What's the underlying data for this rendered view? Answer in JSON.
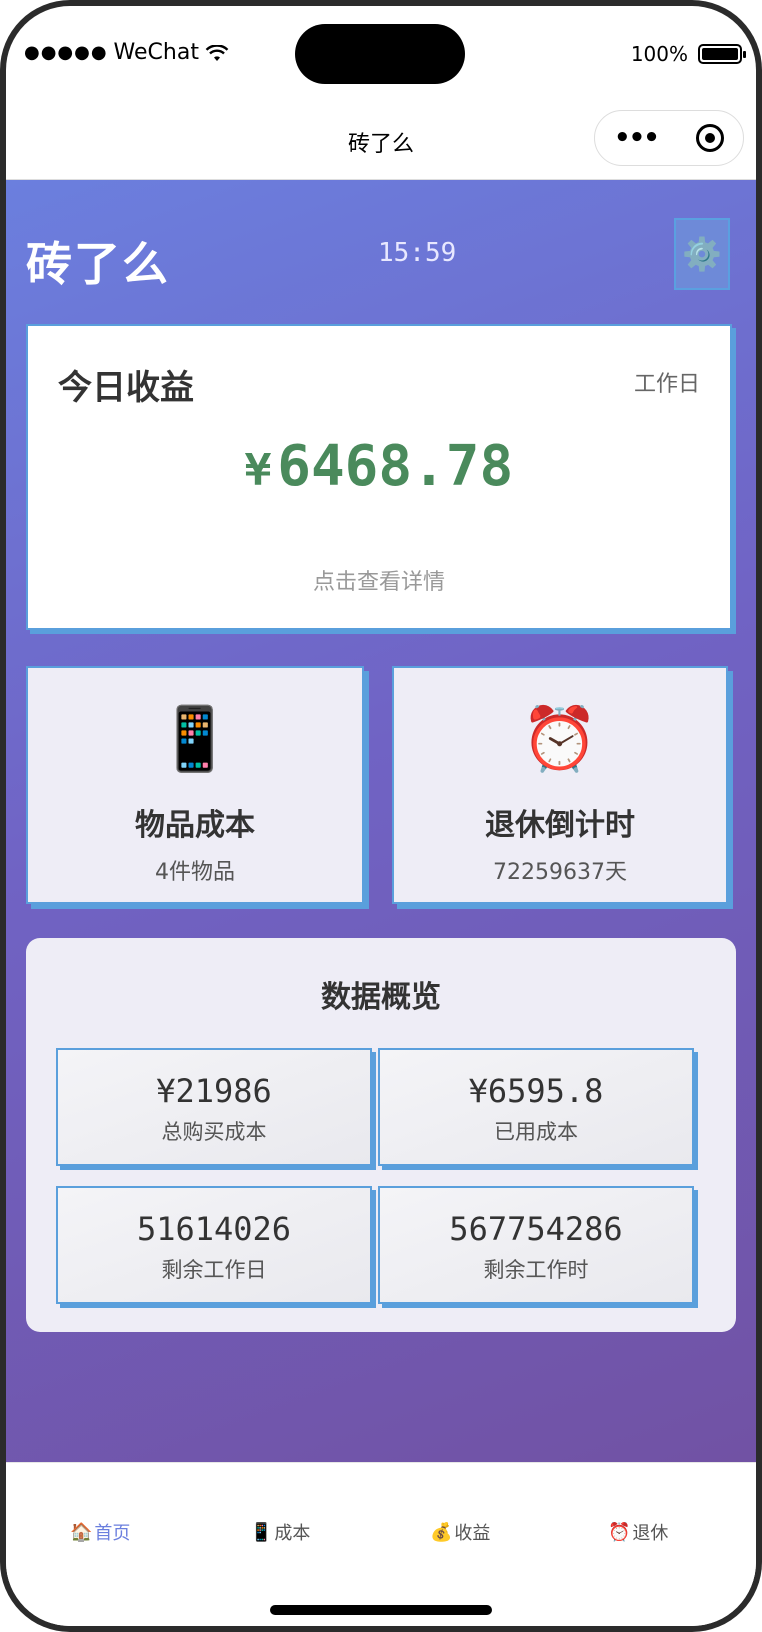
{
  "status_bar": {
    "carrier": "WeChat",
    "battery": "100%"
  },
  "nav": {
    "title": "砖了么"
  },
  "header": {
    "app_title": "砖了么",
    "time": "15:59",
    "settings_icon": "⚙️"
  },
  "income": {
    "label": "今日收益",
    "day_type": "工作日",
    "currency": "¥",
    "amount": "6468.78",
    "hint": "点击查看详情"
  },
  "features": [
    {
      "icon": "📱",
      "title": "物品成本",
      "sub": "4件物品"
    },
    {
      "icon": "⏰",
      "title": "退休倒计时",
      "sub": "72259637天"
    }
  ],
  "overview": {
    "title": "数据概览",
    "stats": [
      {
        "value": "¥21986",
        "label": "总购买成本"
      },
      {
        "value": "¥6595.8",
        "label": "已用成本"
      },
      {
        "value": "51614026",
        "label": "剩余工作日"
      },
      {
        "value": "567754286",
        "label": "剩余工作时"
      }
    ]
  },
  "tabs": [
    {
      "icon": "🏠",
      "label": "首页"
    },
    {
      "icon": "📱",
      "label": "成本"
    },
    {
      "icon": "💰",
      "label": "收益"
    },
    {
      "icon": "⏰",
      "label": "退休"
    }
  ],
  "colors": {
    "accent": "#6b7fde",
    "income_green": "#4a8a5c",
    "card_border": "#5a9fdc"
  }
}
